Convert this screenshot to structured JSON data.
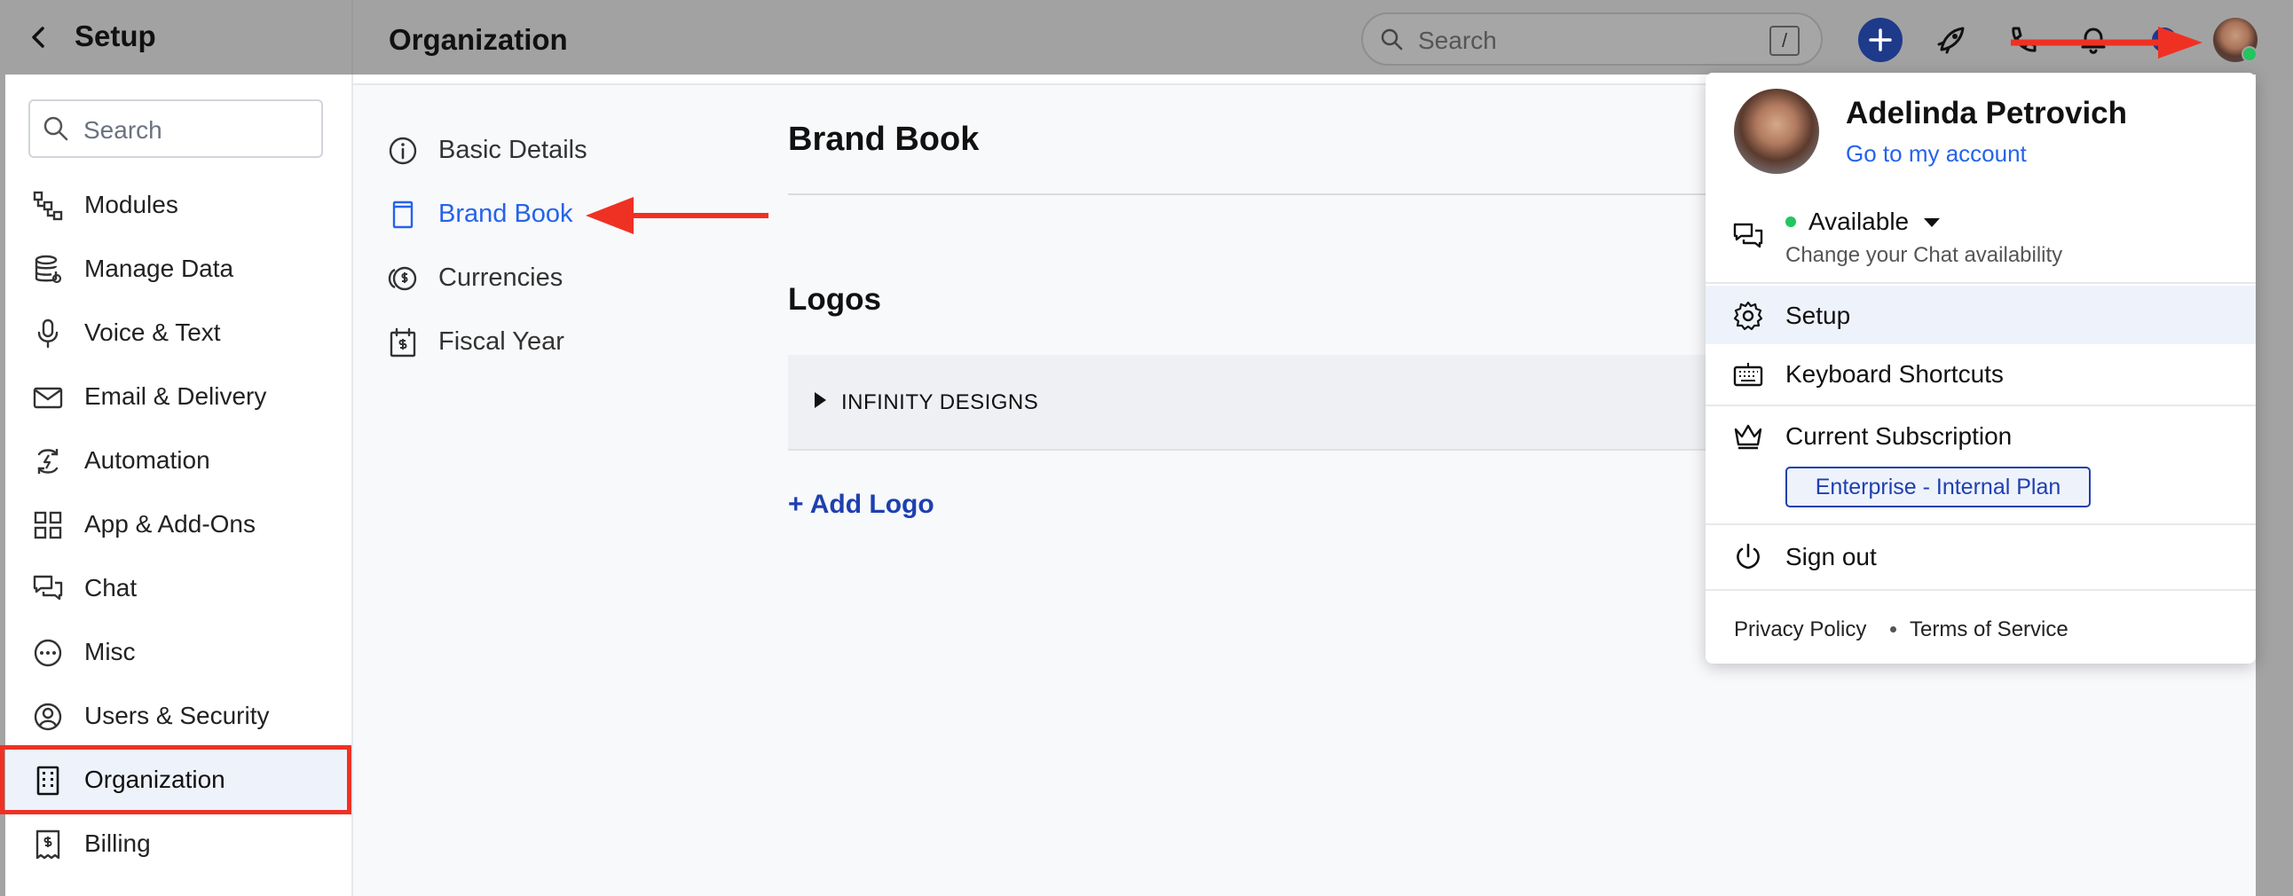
{
  "sidebar": {
    "title": "Setup",
    "search_placeholder": "Search",
    "items": [
      {
        "label": "Modules",
        "icon": "modules-icon"
      },
      {
        "label": "Manage Data",
        "icon": "database-icon"
      },
      {
        "label": "Voice & Text",
        "icon": "microphone-icon"
      },
      {
        "label": "Email & Delivery",
        "icon": "envelope-icon"
      },
      {
        "label": "Automation",
        "icon": "automation-icon"
      },
      {
        "label": "App & Add-Ons",
        "icon": "grid-icon"
      },
      {
        "label": "Chat",
        "icon": "chat-icon"
      },
      {
        "label": "Misc",
        "icon": "ellipsis-circle-icon"
      },
      {
        "label": "Users & Security",
        "icon": "user-circle-icon"
      },
      {
        "label": "Organization",
        "icon": "building-icon"
      },
      {
        "label": "Billing",
        "icon": "receipt-icon"
      }
    ]
  },
  "header": {
    "title": "Organization",
    "search_placeholder": "Search",
    "search_shortcut": "/"
  },
  "subnav": {
    "items": [
      {
        "label": "Basic Details",
        "icon": "info-icon"
      },
      {
        "label": "Brand Book",
        "icon": "book-icon"
      },
      {
        "label": "Currencies",
        "icon": "currency-icon"
      },
      {
        "label": "Fiscal Year",
        "icon": "calendar-icon"
      }
    ]
  },
  "main": {
    "heading": "Brand Book",
    "logos_heading": "Logos",
    "logo_item": "INFINITY DESIGNS",
    "add_logo": "+ Add Logo"
  },
  "user_menu": {
    "name": "Adelinda Petrovich",
    "account_link": "Go to my account",
    "status": "Available",
    "status_sub": "Change your Chat availability",
    "setup": "Setup",
    "keyboard_shortcuts": "Keyboard Shortcuts",
    "subscription": "Current Subscription",
    "plan": "Enterprise - Internal Plan",
    "sign_out": "Sign out",
    "privacy": "Privacy Policy",
    "terms": "Terms of Service"
  },
  "colors": {
    "accent": "#2563eb",
    "accent_dark": "#1e40af",
    "annotation_red": "#ef3124",
    "status_green": "#22c55e"
  }
}
